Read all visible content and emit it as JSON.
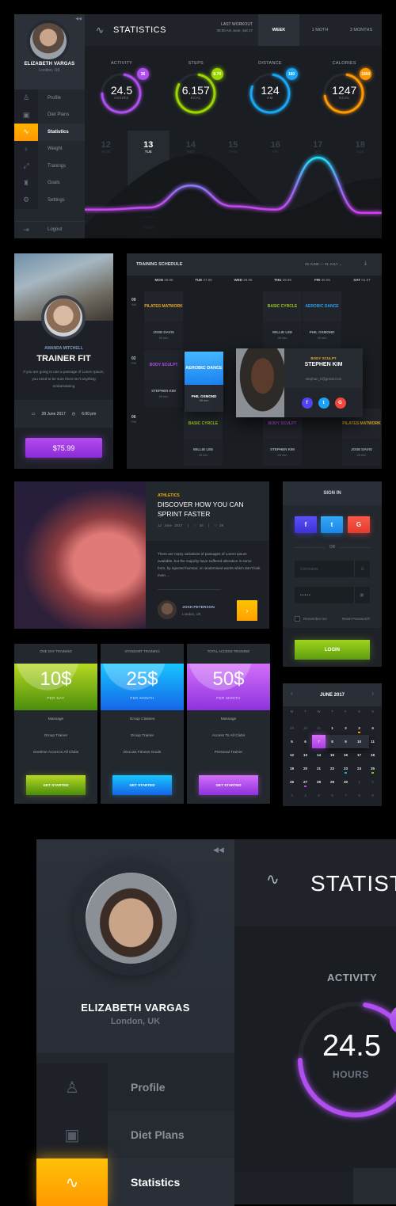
{
  "dashboard": {
    "user": {
      "name": "ELIZABETH VARGAS",
      "location": "London, UK"
    },
    "collapse_icon": "rewind-icon",
    "nav": [
      {
        "label": "Profile",
        "icon": "user-icon",
        "active": false
      },
      {
        "label": "Diet Plans",
        "icon": "calendar-icon",
        "active": false
      },
      {
        "label": "Statistics",
        "icon": "pulse-icon",
        "active": true
      },
      {
        "label": "Weight",
        "icon": "kettlebell-icon",
        "active": false
      },
      {
        "label": "Tranings",
        "icon": "expand-icon",
        "active": false
      },
      {
        "label": "Goals",
        "icon": "trophy-icon",
        "active": false
      },
      {
        "label": "Settings",
        "icon": "gear-icon",
        "active": false
      }
    ],
    "logout_label": "Logout",
    "header": {
      "title": "STATISTICS",
      "last_workout_label": "LAST WORKOUT",
      "last_workout_time": "08:00 Am June, Sat 17",
      "tabs": [
        {
          "label": "WEEK",
          "active": true
        },
        {
          "label": "1 MOTH",
          "active": false
        },
        {
          "label": "3 MONTHS",
          "active": false
        }
      ]
    },
    "metrics": [
      {
        "label": "ACTIVITY",
        "value": "24.5",
        "unit": "HOURS",
        "badge": "36",
        "color": "#b04ef0",
        "progress": 0.72
      },
      {
        "label": "STEPS",
        "value": "6.157",
        "unit": "KCAL",
        "badge": "8.70",
        "color": "#9ad600",
        "progress": 0.8
      },
      {
        "label": "DISTANCE",
        "value": "124",
        "unit": "KM",
        "badge": "160",
        "color": "#1aa6f5",
        "progress": 0.78
      },
      {
        "label": "CALORIES",
        "value": "1247",
        "unit": "KCAL",
        "badge": "1800",
        "color": "#ff9800",
        "progress": 0.7
      }
    ],
    "days": [
      {
        "num": "12",
        "day": "MON",
        "active": false
      },
      {
        "num": "13",
        "day": "TUE",
        "active": true,
        "distance": "45 KM"
      },
      {
        "num": "14",
        "day": "WED",
        "active": false
      },
      {
        "num": "15",
        "day": "THU",
        "active": false
      },
      {
        "num": "16",
        "day": "FRI",
        "active": false
      },
      {
        "num": "17",
        "day": "SAT",
        "active": false
      },
      {
        "num": "18",
        "day": "SUN",
        "active": false
      }
    ],
    "curve_values": [
      0.15,
      0.18,
      0.52,
      0.2,
      0.15,
      0.95,
      0.1
    ]
  },
  "trainer_card": {
    "trainer_name": "AMANDA MITCHELL",
    "title": "TRAINER FIT",
    "description": "If you are going to use a passage of Lorem Ipsum, you need to be sure there isn't anything embarrassing",
    "date": "28 June 2017",
    "time": "6:00 pm",
    "price": "$75.99"
  },
  "schedule": {
    "title": "TRAINING SCHEDULE",
    "range": "26 JUNE — 01 JULY",
    "days": [
      {
        "day": "MON",
        "date": "26.06"
      },
      {
        "day": "TUE",
        "date": "27.06"
      },
      {
        "day": "WED",
        "date": "28.06"
      },
      {
        "day": "THU",
        "date": "29.06"
      },
      {
        "day": "FRI",
        "date": "30.06"
      },
      {
        "day": "SAT",
        "date": "01.07"
      }
    ],
    "times": [
      {
        "hour": "09",
        "ampm": "AM"
      },
      {
        "hour": "02",
        "ampm": "PM"
      },
      {
        "hour": "06",
        "ampm": "PM"
      }
    ],
    "sessions": [
      {
        "class": "PILATES MATWORK",
        "trainer": "JOSE DAVIS",
        "duration": "55 min",
        "color": "#e5a928",
        "col": 0,
        "row": 0
      },
      {
        "class": "BASIC CYRCLE",
        "trainer": "WILLIE LEE",
        "duration": "35 min",
        "color": "#9ac41e",
        "col": 3,
        "row": 0
      },
      {
        "class": "AEROBIC DANCE",
        "trainer": "PHIL OSMOND",
        "duration": "45 min",
        "color": "#2aa0ee",
        "col": 4,
        "row": 0
      },
      {
        "class": "BODY SCULPT",
        "trainer": "STEPHEN KIM",
        "duration": "45 min",
        "color": "#b24de8",
        "col": 0,
        "row": 1
      },
      {
        "class": "BASIC CYRCLE",
        "trainer": "WILLIE LEE",
        "duration": "35 min",
        "color": "#9ac41e",
        "col": 1,
        "row": 2
      },
      {
        "class": "BODY SCULPT",
        "trainer": "STEPHEN KIM",
        "duration": "45 min",
        "color": "#b24de8",
        "col": 3,
        "row": 2
      },
      {
        "class": "PILATES MATWORK",
        "trainer": "JOSE DAVIS",
        "duration": "55 min",
        "color": "#e5a928",
        "col": 5,
        "row": 2
      }
    ],
    "highlight": {
      "class": "AEROBIC DANCE",
      "trainer": "PHIL OSMOND",
      "duration": "45 min"
    },
    "popup": {
      "tag": "BODY SCULPT",
      "name": "STEPHEN KIM",
      "email": "stephan_k@gmail.com",
      "social": [
        "f",
        "t",
        "G"
      ]
    }
  },
  "article": {
    "category": "ATHLETICS",
    "title": "DISCOVER HOW YOU CAN SPRINT FASTER",
    "date": "12 June 2017",
    "likes": "34",
    "comments": "28",
    "body": "There are many variations of passages of Lorem Ipsum available, but the majority have suffered alteration in some form, by injected humour, or randomised words which don't look even ...",
    "author": "JOSH PETERSON",
    "author_location": "London, UK",
    "next_icon": "chevron-right-icon"
  },
  "signin": {
    "title": "SIGN IN",
    "social": [
      {
        "label": "f",
        "color": "#4b3ff0"
      },
      {
        "label": "t",
        "color": "#1d94f2"
      },
      {
        "label": "G",
        "color": "#f3473b"
      }
    ],
    "or_label": "OR",
    "username_placeholder": "Username",
    "password_value": "•••••",
    "remember_label": "Remember me",
    "reset_label": "Reset Password?",
    "login_label": "LOGIN"
  },
  "pricing": [
    {
      "title": "ONE DAY TRAINING",
      "price": "10$",
      "period": "PER DAY",
      "features": [
        "Massage",
        "Group Trainer",
        "Onetime Acces to All Clubs"
      ],
      "cta": "GET STARTED",
      "color_top": "#b6d922",
      "color_bottom": "#4a8d0c"
    },
    {
      "title": "STANDART TRAINING",
      "price": "25$",
      "period": "PER MONTH",
      "features": [
        "Group Classes",
        "Group Trainer",
        "Discuss Fitness Goals"
      ],
      "cta": "GET STARTED",
      "color_top": "#18c6ff",
      "color_bottom": "#1565e8"
    },
    {
      "title": "TOTAL ACCESS TRAINING",
      "price": "50$",
      "period": "PER MONTH",
      "features": [
        "Massage",
        "Access To All Clubs",
        "Personal Trainer"
      ],
      "cta": "GET STARTED",
      "color_top": "#d36ff8",
      "color_bottom": "#8d32df"
    }
  ],
  "calendar": {
    "title": "JUNE 2017",
    "weekdays": [
      "M",
      "T",
      "W",
      "T",
      "F",
      "S",
      "S"
    ],
    "weeks": [
      [
        {
          "d": "29",
          "o": true
        },
        {
          "d": "30",
          "o": true
        },
        {
          "d": "31",
          "o": true
        },
        {
          "d": "1"
        },
        {
          "d": "2"
        },
        {
          "d": "3",
          "dot": "#ff9800"
        },
        {
          "d": "4"
        }
      ],
      [
        {
          "d": "5"
        },
        {
          "d": "6"
        },
        {
          "d": "7",
          "sel": true
        },
        {
          "d": "8"
        },
        {
          "d": "9"
        },
        {
          "d": "10"
        },
        {
          "d": "11"
        }
      ],
      [
        {
          "d": "12"
        },
        {
          "d": "13"
        },
        {
          "d": "14"
        },
        {
          "d": "15"
        },
        {
          "d": "16"
        },
        {
          "d": "17"
        },
        {
          "d": "18"
        }
      ],
      [
        {
          "d": "19"
        },
        {
          "d": "20"
        },
        {
          "d": "21"
        },
        {
          "d": "22"
        },
        {
          "d": "23",
          "dot": "#1aa6f5"
        },
        {
          "d": "24"
        },
        {
          "d": "25",
          "dot": "#8bc400"
        }
      ],
      [
        {
          "d": "26"
        },
        {
          "d": "27",
          "dot": "#b04ef0"
        },
        {
          "d": "28"
        },
        {
          "d": "29"
        },
        {
          "d": "30"
        },
        {
          "d": "1",
          "o": true
        },
        {
          "d": "2",
          "o": true
        }
      ],
      [
        {
          "d": "3",
          "o": true
        },
        {
          "d": "4",
          "o": true
        },
        {
          "d": "5",
          "o": true
        },
        {
          "d": "6",
          "o": true
        },
        {
          "d": "7",
          "o": true
        },
        {
          "d": "8",
          "o": true
        },
        {
          "d": "9",
          "o": true
        }
      ]
    ]
  },
  "zoom_detail": {
    "user": {
      "name": "ELIZABETH VARGAS",
      "location": "London, UK"
    },
    "nav": [
      {
        "label": "Profile",
        "icon": "user-icon"
      },
      {
        "label": "Diet Plans",
        "icon": "calendar-icon"
      },
      {
        "label": "Statistics",
        "icon": "pulse-icon",
        "active": true
      }
    ],
    "title": "STATISTICS",
    "metric_label": "ACTIVITY",
    "metric_value": "24.5",
    "metric_unit": "HOURS"
  }
}
